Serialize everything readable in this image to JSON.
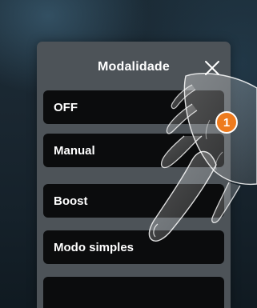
{
  "modal": {
    "title": "Modalidade",
    "close_icon": "close-icon"
  },
  "options": [
    {
      "label": "OFF"
    },
    {
      "label": "Manual"
    },
    {
      "label": "Boost"
    },
    {
      "label": "Modo simples"
    },
    {
      "label": ""
    }
  ],
  "step_badge": {
    "number": "1",
    "color": "#ee7b1e"
  },
  "colors": {
    "modal_background": "#4d5358",
    "option_background": "#0b0c0d",
    "text": "#ffffff",
    "screen_background": "#1a2731"
  },
  "overlay": {
    "icon": "pointing-hand-icon"
  }
}
